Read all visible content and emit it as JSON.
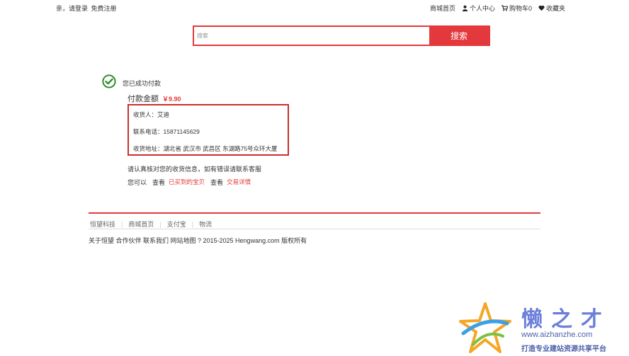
{
  "topbar": {
    "greeting": "亲，请登录",
    "register": "免费注册",
    "home": "商城首页",
    "profile": "个人中心",
    "cart": "购物车0",
    "favorites": "收藏夹"
  },
  "search": {
    "placeholder": "搜索",
    "button": "搜索"
  },
  "payment": {
    "success_text": "您已成功付款",
    "amount_label": "付款金额",
    "amount_value": "￥9.90",
    "receiver": "收货人：艾迪",
    "phone": "联系电话：15871145629",
    "address": "收货地址：湖北省 武汉市 武昌区 东湖路75号众环大厦",
    "notice": "请认真核对您的收货信息，如有错误请联系客服",
    "you_can": "您可以",
    "view1": "查看",
    "link1": "已买到的宝贝",
    "view2": "查看",
    "link2": "交易详情"
  },
  "footer": {
    "nav": [
      "恒望科技",
      "商城首页",
      "支付宝",
      "物流"
    ],
    "copyright": "关于恒望 合作伙伴 联系我们 网站地图 ? 2015-2025 Hengwang.com 版权所有"
  },
  "watermark": {
    "title": "懒之才",
    "url": "www.aizhanzhe.com",
    "slogan": "打造专业建站资源共享平台"
  },
  "colors": {
    "accent": "#e4393c",
    "success": "#2e8b2e"
  }
}
